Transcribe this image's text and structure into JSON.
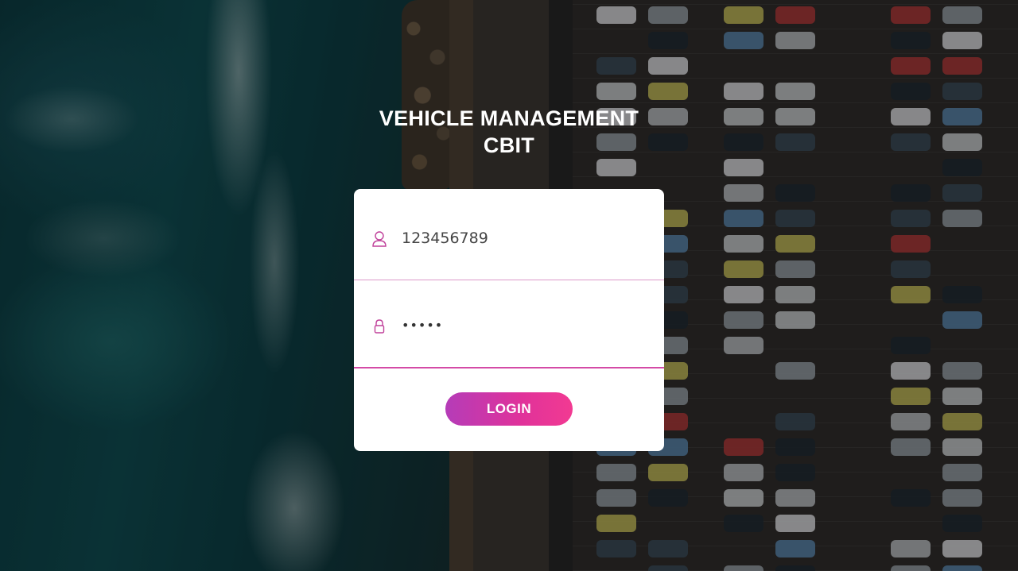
{
  "app": {
    "title_line1": "VEHICLE MANAGEMENT",
    "title_line2": "CBIT"
  },
  "login_form": {
    "username_value": "123456789",
    "password_value": "•••••",
    "login_label": "LOGIN",
    "username_icon": "user-icon",
    "password_icon": "lock-icon"
  },
  "colors": {
    "accent_start": "#b53cb8",
    "accent_end": "#f23a92",
    "icon": "#c0409a"
  }
}
